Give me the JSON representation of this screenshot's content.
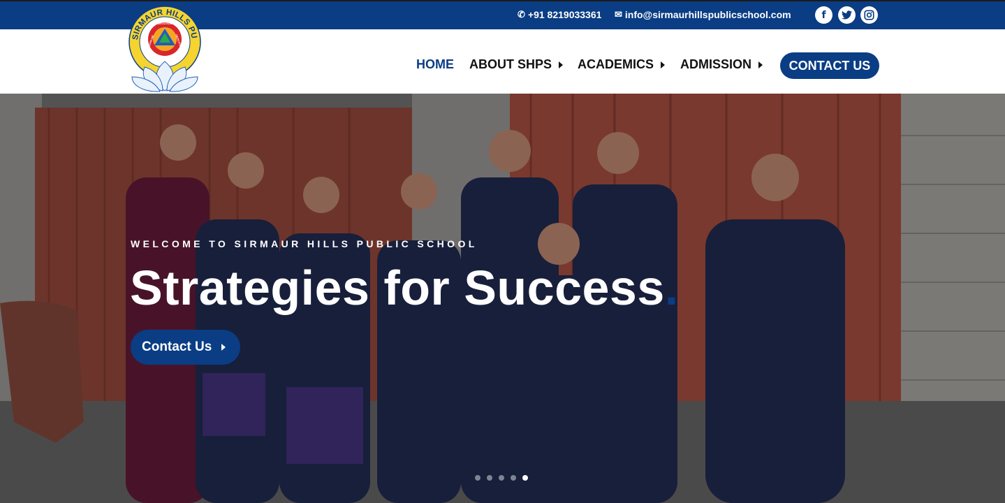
{
  "topbar": {
    "phone": "+91 8219033361",
    "email": "info@sirmaurhillspublicschool.com",
    "social": [
      {
        "name": "facebook",
        "glyph": "f"
      },
      {
        "name": "twitter",
        "glyph": "t"
      },
      {
        "name": "instagram",
        "glyph": "◎"
      }
    ]
  },
  "logo": {
    "ring_text": "SIRMAUR HILLS PUBLIC SCHOOL",
    "inner_top": "DEVOTION",
    "inner_left": "DISCIPLINE",
    "inner_right": "DEDICATION"
  },
  "nav": {
    "home": "HOME",
    "about": "ABOUT SHPS",
    "academics": "ACADEMICS",
    "admission": "ADMISSION",
    "contact": "CONTACT US"
  },
  "hero": {
    "welcome": "WELCOME TO SIRMAUR HILLS PUBLIC SCHOOL",
    "headline": "Strategies for Success",
    "headline_dot": ".",
    "button": "Contact Us",
    "slides": 5,
    "active_slide": 5
  },
  "colors": {
    "brand": "#0a3d84",
    "topbar": "#0a3d84"
  }
}
